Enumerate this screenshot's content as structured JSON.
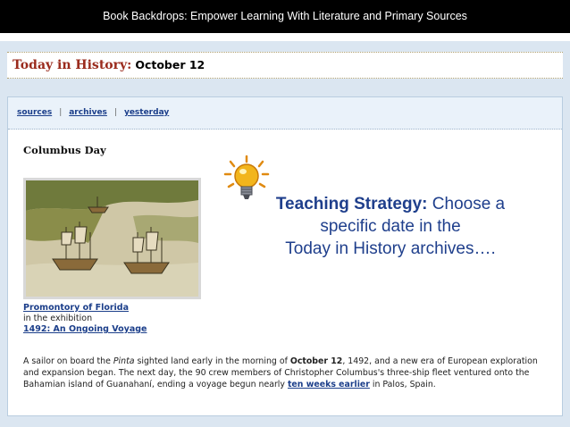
{
  "header": {
    "title": "Book Backdrops: Empower Learning With Literature and Primary Sources"
  },
  "tih": {
    "title": "Today in History:",
    "date": "October 12"
  },
  "nav": {
    "sources": "sources",
    "sep1": "|",
    "archives": "archives",
    "sep2": "|",
    "yesterday": "yesterday"
  },
  "event": {
    "title": "Columbus Day"
  },
  "caption": {
    "link": "Promontory of Florida",
    "line2": "in the exhibition",
    "exhibit": "1492: An Ongoing Voyage"
  },
  "paragraph": {
    "p1": "A sailor on board the ",
    "ship": "Pinta",
    "p2": " sighted land early in the morning of ",
    "date": "October 12",
    "p3": ", 1492, and a new era of European exploration and expansion began. The next day, the 90 crew members of Christopher Columbus's three-ship fleet ventured onto the Bahamian island of Guanahaní, ending a voyage begun nearly ",
    "link": "ten weeks earlier",
    "p4": " in Palos, Spain."
  },
  "strategy": {
    "label": "Teaching Strategy:",
    "text1": " Choose a specific date in the",
    "text2": "Today in History archives…."
  },
  "colors": {
    "accent": "#1f3f8c",
    "link": "#1b3e8a",
    "tih_red": "#9a2a1c",
    "bulb": "#f2b51c"
  },
  "icons": {
    "bulb": "lightbulb-icon"
  }
}
